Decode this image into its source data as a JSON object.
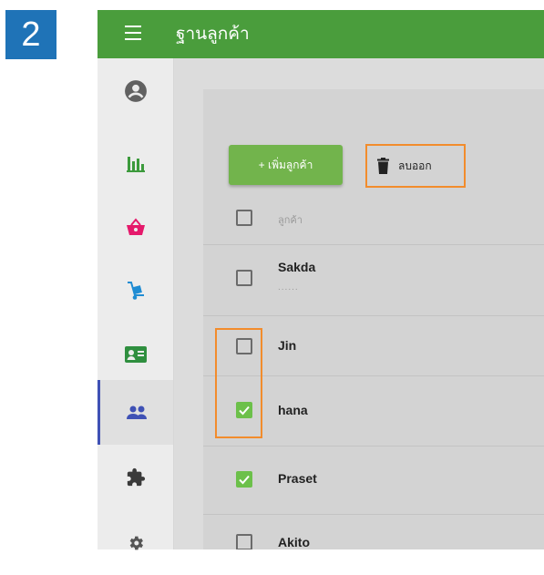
{
  "step": {
    "number": "2"
  },
  "appbar": {
    "title": "ฐานลูกค้า"
  },
  "sidebar": {
    "items": [
      {
        "icon": "account-circle-icon",
        "color": "#616161"
      },
      {
        "icon": "bar-chart-icon",
        "color": "#3c9a3c"
      },
      {
        "icon": "shopping-basket-icon",
        "color": "#e5196b"
      },
      {
        "icon": "hand-truck-icon",
        "color": "#1f8cd3"
      },
      {
        "icon": "contact-card-icon",
        "color": "#2f8f3f"
      },
      {
        "icon": "people-icon",
        "color": "#3f51b5",
        "active": true
      },
      {
        "icon": "puzzle-icon",
        "color": "#3a3a3a"
      },
      {
        "icon": "gear-icon",
        "color": "#555555"
      }
    ]
  },
  "toolbar": {
    "add_label": "+ เพิ่มลูกค้า",
    "delete_label": "ลบออก"
  },
  "table": {
    "header_label": "ลูกค้า",
    "rows": [
      {
        "name": "Sakda",
        "sub": "......",
        "checked": false
      },
      {
        "name": "Jin",
        "checked": false
      },
      {
        "name": "hana",
        "checked": true
      },
      {
        "name": "Praset",
        "checked": true
      },
      {
        "name": "Akito",
        "checked": false
      }
    ]
  },
  "colors": {
    "accent": "#4a9d3c",
    "highlight": "#f28c2c",
    "check": "#6cc04a"
  }
}
